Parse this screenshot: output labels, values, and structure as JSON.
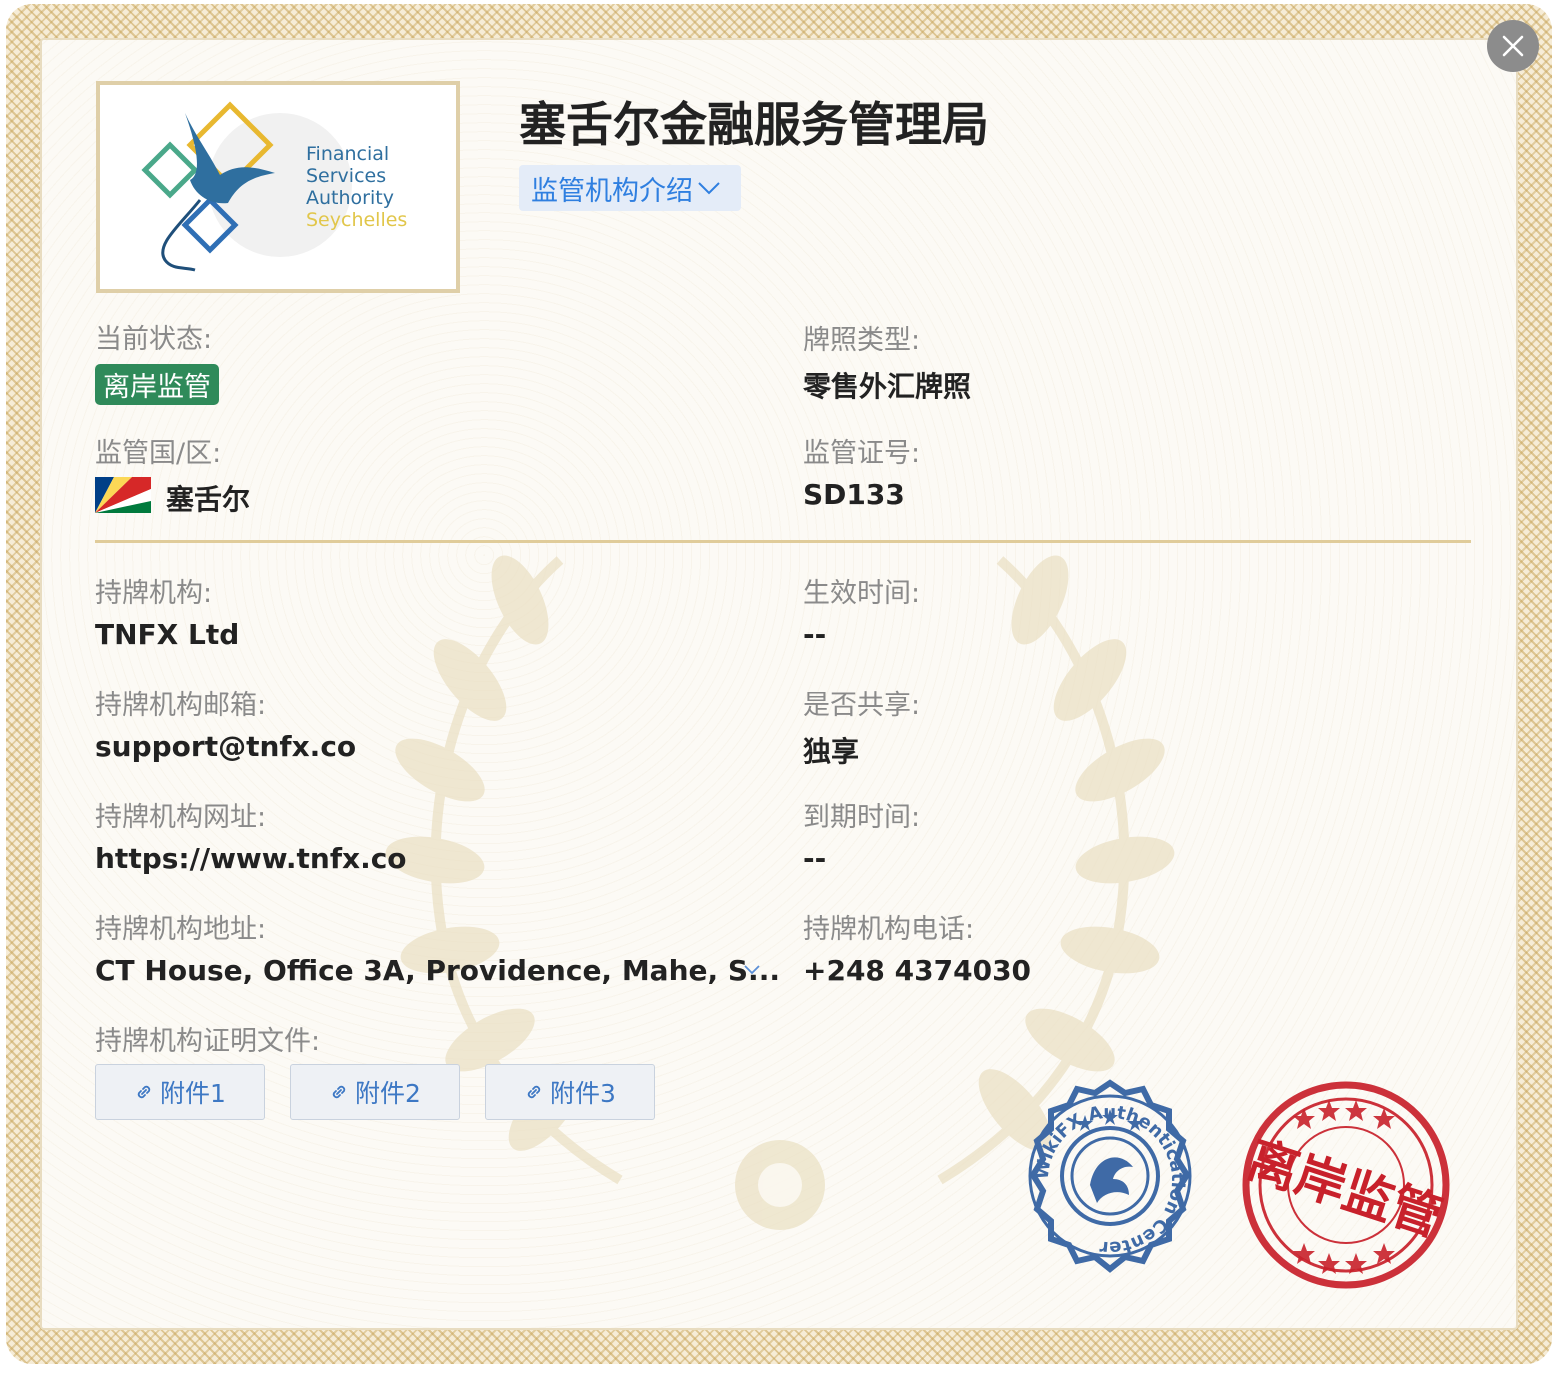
{
  "header": {
    "title": "塞舌尔金融服务管理局",
    "intro_button": "监管机构介绍"
  },
  "logo": {
    "line1": "Financial",
    "line2": "Services",
    "line3": "Authority",
    "line4": "Seychelles"
  },
  "fields": {
    "status_label": "当前状态:",
    "status_value": "离岸监管",
    "license_type_label": "牌照类型:",
    "license_type_value": "零售外汇牌照",
    "region_label": "监管国/区:",
    "region_value": "塞舌尔",
    "license_no_label": "监管证号:",
    "license_no_value": "SD133",
    "holder_label": "持牌机构:",
    "holder_value": "TNFX Ltd",
    "effective_label": "生效时间:",
    "effective_value": "--",
    "email_label": "持牌机构邮箱:",
    "email_value": "support@tnfx.co",
    "shared_label": "是否共享:",
    "shared_value": "独享",
    "website_label": "持牌机构网址:",
    "website_value": "https://www.tnfx.co",
    "expiry_label": "到期时间:",
    "expiry_value": "--",
    "address_label": "持牌机构地址:",
    "address_value": "CT House, Office 3A, Providence, Mahe, S...",
    "phone_label": "持牌机构电话:",
    "phone_value": "+248 4374030",
    "docs_label": "持牌机构证明文件:"
  },
  "attachments": [
    "附件1",
    "附件2",
    "附件3"
  ],
  "seals": {
    "blue_text": "WikiFX Authentication Center",
    "red_text": "离岸监管"
  },
  "colors": {
    "badge_green": "#2f8a5a",
    "link_blue": "#2f7fe0",
    "seal_blue": "#3f6aa6",
    "seal_red": "#c8212b",
    "frame_gold": "#d9c48f"
  }
}
